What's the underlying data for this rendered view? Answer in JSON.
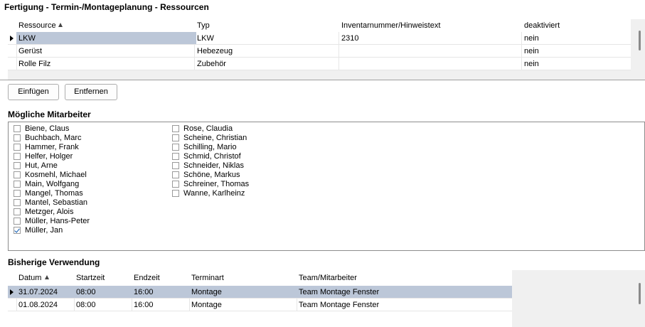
{
  "window": {
    "title": "Fertigung - Termin-/Montageplanung - Ressourcen"
  },
  "resources": {
    "columns": [
      "Ressource",
      "Typ",
      "Inventarnummer/Hinweistext",
      "deaktiviert"
    ],
    "sorted_column": "Ressource",
    "rows": [
      {
        "ressource": "LKW",
        "typ": "LKW",
        "inventar": "2310",
        "deaktiviert": "nein",
        "selected": true
      },
      {
        "ressource": "Gerüst",
        "typ": "Hebezeug",
        "inventar": "",
        "deaktiviert": "nein",
        "selected": false
      },
      {
        "ressource": "Rolle Filz",
        "typ": "Zubehör",
        "inventar": "",
        "deaktiviert": "nein",
        "selected": false
      }
    ]
  },
  "buttons": {
    "add": "Einfügen",
    "remove": "Entfernen"
  },
  "employees": {
    "title": "Mögliche Mitarbeiter",
    "col1": [
      {
        "name": "Biene, Claus",
        "checked": false
      },
      {
        "name": "Buchbach, Marc",
        "checked": false
      },
      {
        "name": "Hammer, Frank",
        "checked": false
      },
      {
        "name": "Helfer, Holger",
        "checked": false
      },
      {
        "name": "Hut, Arne",
        "checked": false
      },
      {
        "name": "Kosmehl, Michael",
        "checked": false
      },
      {
        "name": "Main, Wolfgang",
        "checked": false
      },
      {
        "name": "Mangel, Thomas",
        "checked": false
      },
      {
        "name": "Mantel, Sebastian",
        "checked": false
      },
      {
        "name": "Metzger, Alois",
        "checked": false
      },
      {
        "name": "Müller, Hans-Peter",
        "checked": false
      },
      {
        "name": "Müller, Jan",
        "checked": true
      }
    ],
    "col2": [
      {
        "name": "Rose, Claudia",
        "checked": false
      },
      {
        "name": "Scheine, Christian",
        "checked": false
      },
      {
        "name": "Schilling, Mario",
        "checked": false
      },
      {
        "name": "Schmid, Christof",
        "checked": false
      },
      {
        "name": "Schneider, Niklas",
        "checked": false
      },
      {
        "name": "Schöne, Markus",
        "checked": false
      },
      {
        "name": "Schreiner, Thomas",
        "checked": false
      },
      {
        "name": "Wanne, Karlheinz",
        "checked": false
      }
    ]
  },
  "usage": {
    "title": "Bisherige Verwendung",
    "columns": [
      "Datum",
      "Startzeit",
      "Endzeit",
      "Terminart",
      "Team/Mitarbeiter"
    ],
    "sorted_column": "Datum",
    "rows": [
      {
        "datum": "31.07.2024",
        "start": "08:00",
        "ende": "16:00",
        "art": "Montage",
        "team": "Team Montage Fenster",
        "selected": true
      },
      {
        "datum": "01.08.2024",
        "start": "08:00",
        "ende": "16:00",
        "art": "Montage",
        "team": "Team Montage Fenster",
        "selected": false
      }
    ]
  },
  "colors": {
    "selection": "#bcc7d8",
    "check": "#0b58b0",
    "panel": "#f0f0f0"
  },
  "icons": [
    "row-indicator-icon",
    "sort-ascending-icon",
    "checkmark-icon"
  ]
}
